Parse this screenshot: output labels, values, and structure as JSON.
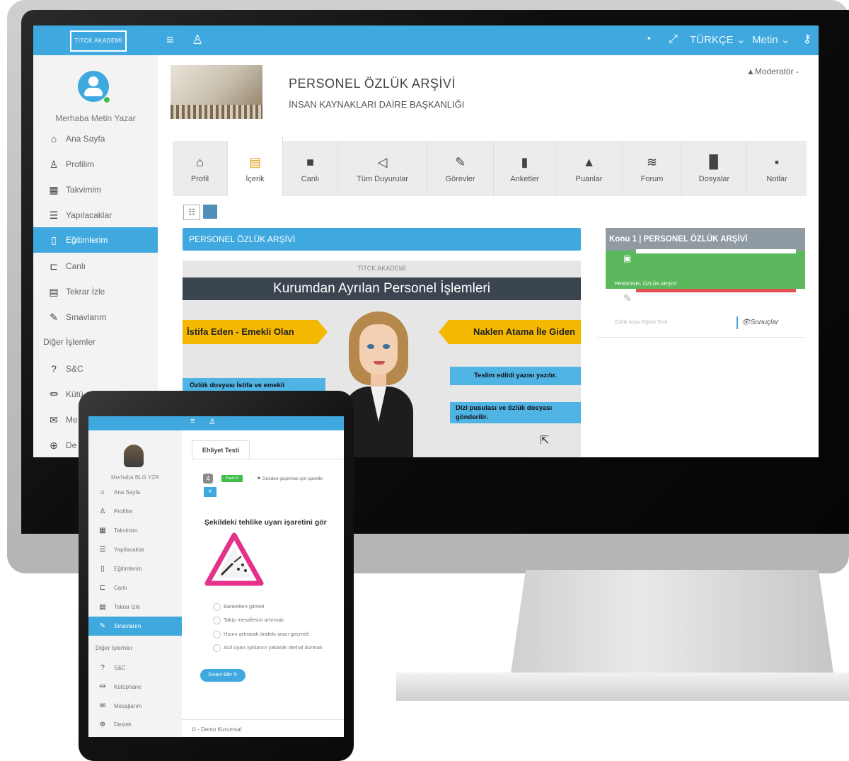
{
  "desktop": {
    "topbar": {
      "logo_text": "TİTCK AKADEMİ",
      "language": "TÜRKÇE ⌄",
      "user": "Metin ⌄"
    },
    "sidebar": {
      "greeting": "Merhaba Metin Yazar",
      "items": [
        {
          "label": "Ana Sayfa",
          "icon": "home-icon"
        },
        {
          "label": "Profilim",
          "icon": "user-icon"
        },
        {
          "label": "Takvimim",
          "icon": "calendar-icon"
        },
        {
          "label": "Yapılacaklar",
          "icon": "list-icon"
        },
        {
          "label": "Eğitimlerim",
          "icon": "book-icon",
          "active": true
        },
        {
          "label": "Canlı",
          "icon": "video-icon"
        },
        {
          "label": "Tekrar İzle",
          "icon": "replay-icon"
        },
        {
          "label": "Sınavlarım",
          "icon": "exam-icon"
        }
      ],
      "other_heading": "Diğer İşlemler",
      "other_items": [
        {
          "label": "S&C",
          "icon": "question-icon"
        },
        {
          "label": "Kütü",
          "icon": "library-icon"
        },
        {
          "label": "Me",
          "icon": "mail-icon"
        },
        {
          "label": "De",
          "icon": "support-icon"
        }
      ]
    },
    "header": {
      "title": "PERSONEL ÖZLÜK ARŞİVİ",
      "subtitle": "İNSAN KAYNAKLARI DAİRE BAŞKANLIĞI",
      "role": "▲Moderatör -"
    },
    "tabs": [
      {
        "label": "Profil",
        "icon": "home-icon"
      },
      {
        "label": "İçerik",
        "icon": "content-icon",
        "active": true
      },
      {
        "label": "Canlı",
        "icon": "camera-icon"
      },
      {
        "label": "Tüm Duyurular",
        "icon": "megaphone-icon"
      },
      {
        "label": "Görevler",
        "icon": "pencil-icon"
      },
      {
        "label": "Anketler",
        "icon": "bookmark-icon"
      },
      {
        "label": "Puanlar",
        "icon": "graduation-icon"
      },
      {
        "label": "Forum",
        "icon": "forum-icon"
      },
      {
        "label": "Dosyalar",
        "icon": "file-icon"
      },
      {
        "label": "Notlar",
        "icon": "note-icon"
      }
    ],
    "panel": {
      "title": "PERSONEL ÖZLÜK ARŞİVİ",
      "video": {
        "brand": "TİTCK AKADEMİ",
        "title": "Kurumdan Ayrılan Personel İşlemleri",
        "left_arrow": "İstifa Eden - Emekli Olan",
        "right_arrow": "Naklen Atama İle Giden",
        "left_box": "Özlük dosyası İstifa ve emekli",
        "right_box1": "Teslim edildi yazısı yazılır.",
        "right_box2": "Dizi pusulası ve özlük dosyası gönderilir."
      }
    },
    "topic_card": {
      "title": "Konu 1 | PERSONEL ÖZLÜK ARŞİVİ",
      "note": "PERSONEL ÖZLÜK ARŞİVİ",
      "test_label": "Özlük Arşivi Eğitim Testi",
      "results_button": "👁Sonuçlar",
      "progress": 1.0
    }
  },
  "tablet": {
    "sidebar": {
      "greeting": "Merhaba BLG YZR",
      "items": [
        {
          "label": "Ana Sayfa",
          "icon": "home-icon"
        },
        {
          "label": "Profilim",
          "icon": "user-icon"
        },
        {
          "label": "Takvimim",
          "icon": "calendar-icon"
        },
        {
          "label": "Yapılacaklar",
          "icon": "list-icon"
        },
        {
          "label": "Eğitimlerim",
          "icon": "book-icon"
        },
        {
          "label": "Canlı",
          "icon": "video-icon"
        },
        {
          "label": "Tekrar İzle",
          "icon": "replay-icon"
        },
        {
          "label": "Sınavlarım",
          "icon": "exam-icon",
          "active": true
        }
      ],
      "other_heading": "Diğer İşlemler",
      "other_items": [
        {
          "label": "S&C",
          "icon": "question-icon"
        },
        {
          "label": "Kütüphane",
          "icon": "library-icon"
        },
        {
          "label": "Mesajlarım",
          "icon": "mail-icon"
        },
        {
          "label": "Destek",
          "icon": "support-icon"
        }
      ]
    },
    "exam": {
      "tab": "Ehliyet Testi",
      "question_number": "4",
      "badge": "Puan:10",
      "review": "Gözden geçirmek için işaretle",
      "hash": "#",
      "question": "Şekildeki tehlike uyarı işaretini gör",
      "options": [
        "Banketten gitmeli",
        "Takip mesafesini artırmalı",
        "Hızını artırarak öndeki aracı geçmeli",
        "Acil uyarı ışıklarını yakarak derhal durmalı"
      ],
      "finish_button": "Sınavı Bitir ↻"
    },
    "footer": "© - Demo Kurumsal"
  }
}
